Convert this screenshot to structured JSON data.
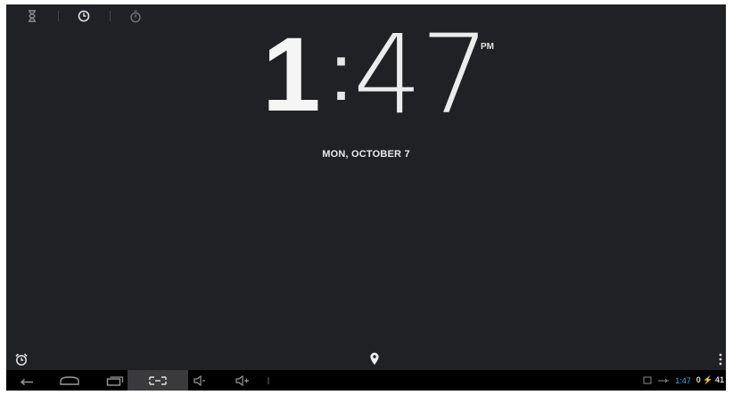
{
  "tabs": [
    {
      "name": "timer",
      "icon": "hourglass-icon"
    },
    {
      "name": "clock",
      "icon": "clock-icon"
    },
    {
      "name": "stopwatch",
      "icon": "stopwatch-icon"
    }
  ],
  "clock": {
    "hour": "1",
    "colon": ":",
    "minutes": "47",
    "ampm": "PM"
  },
  "date": "MON, OCTOBER 7",
  "actions": {
    "alarm_icon": "alarm-icon",
    "location_icon": "location-pin-icon",
    "overflow_icon": "overflow-menu-icon"
  },
  "system_bar": {
    "nav_icons": [
      "back-icon",
      "home-icon",
      "recent-apps-icon",
      "screenshot-icon",
      "volume-down-icon",
      "volume-up-icon",
      "more-icon"
    ],
    "status_time": "1:47",
    "status_battery": "0 ⚡ 41"
  },
  "colors": {
    "background": "#202124",
    "system_bar": "#000000",
    "accent": "#33b5e5"
  }
}
